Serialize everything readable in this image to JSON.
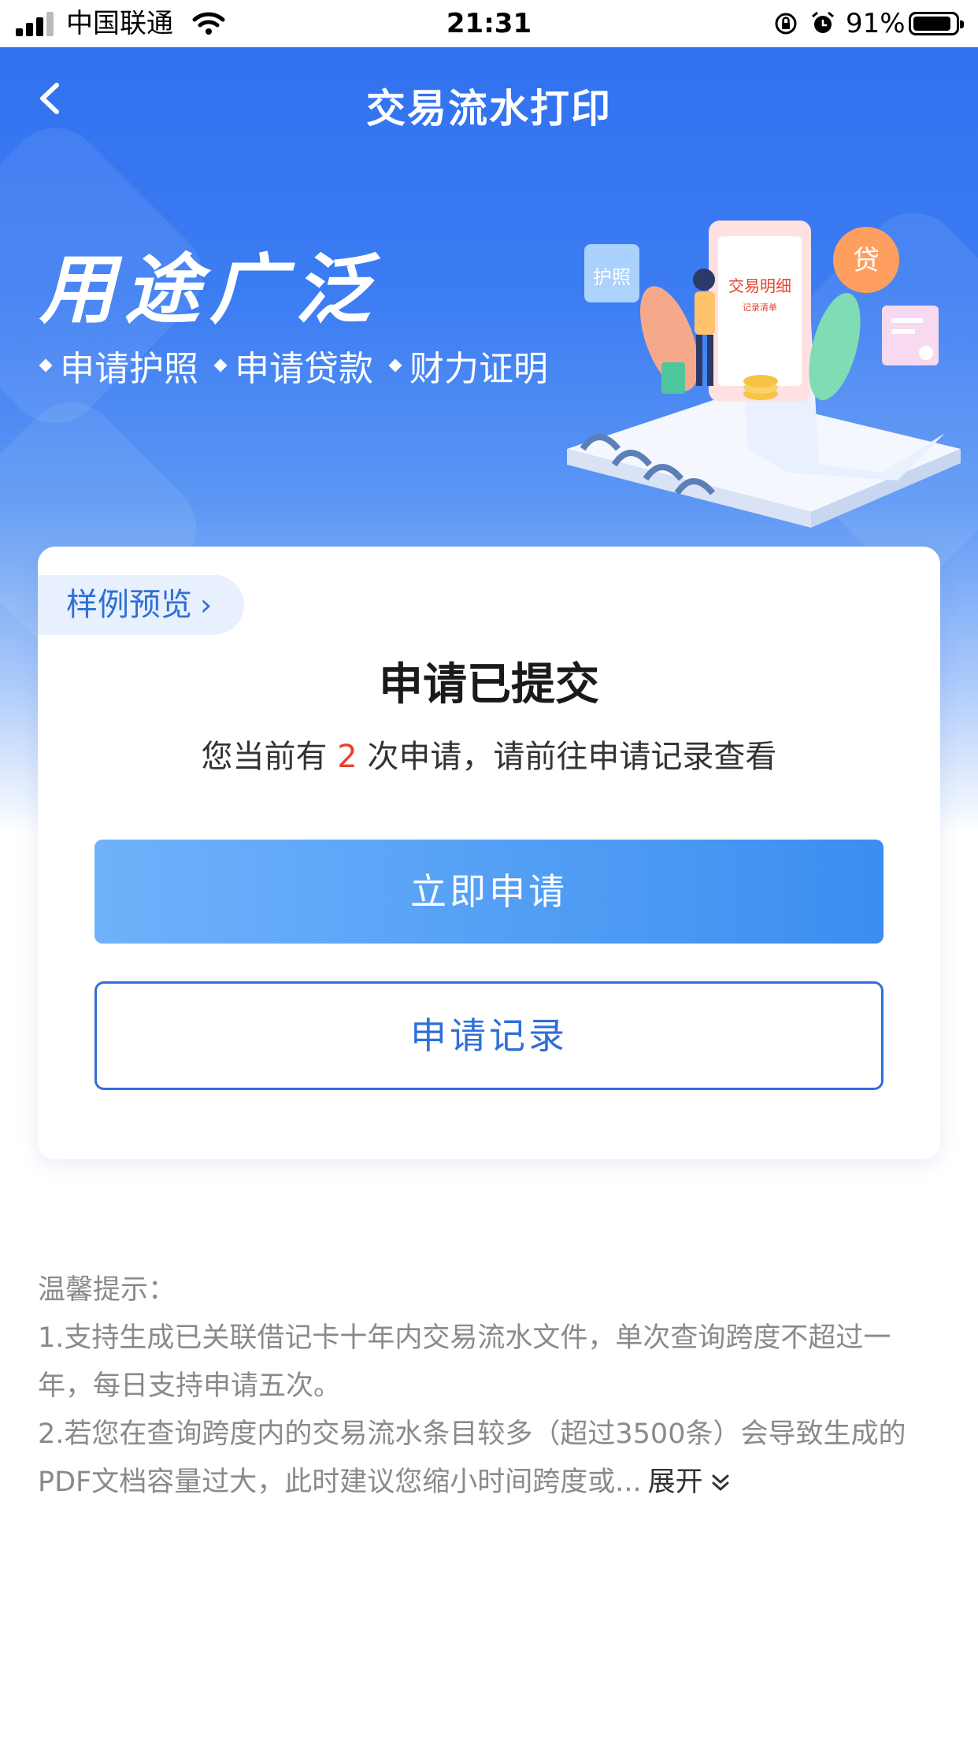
{
  "status_bar": {
    "carrier": "中国联通",
    "time": "21:31",
    "battery_percent": 91,
    "battery_label": "91%"
  },
  "nav": {
    "title": "交易流水打印",
    "back_icon": "chevron-left-icon"
  },
  "banner": {
    "title": "用途广泛",
    "tags": [
      "申请护照",
      "申请贷款",
      "财力证明"
    ],
    "illustration": {
      "badge_passport": "护照",
      "doc_title": "交易明细",
      "doc_subtitle": "记录清单",
      "badge_loan": "贷"
    }
  },
  "card": {
    "sample_link": "样例预览",
    "title": "申请已提交",
    "desc_prefix": "您当前有 ",
    "desc_count": "2",
    "desc_suffix": " 次申请，请前往申请记录查看",
    "primary_button": "立即申请",
    "secondary_button": "申请记录"
  },
  "tips": {
    "heading": "温馨提示：",
    "line1": "1.支持生成已关联借记卡十年内交易流水文件，单次查询跨度不超过一年，每日支持申请五次。",
    "line2": "2.若您在查询跨度内的交易流水条目较多（超过3500条）会导致生成的PDF文档容量过大，此时建议您缩小时间跨度或...",
    "expand_label": "展开"
  },
  "colors": {
    "brand_blue": "#2f6ff0",
    "link_blue": "#2f6fd8",
    "highlight_red": "#e8412c"
  }
}
